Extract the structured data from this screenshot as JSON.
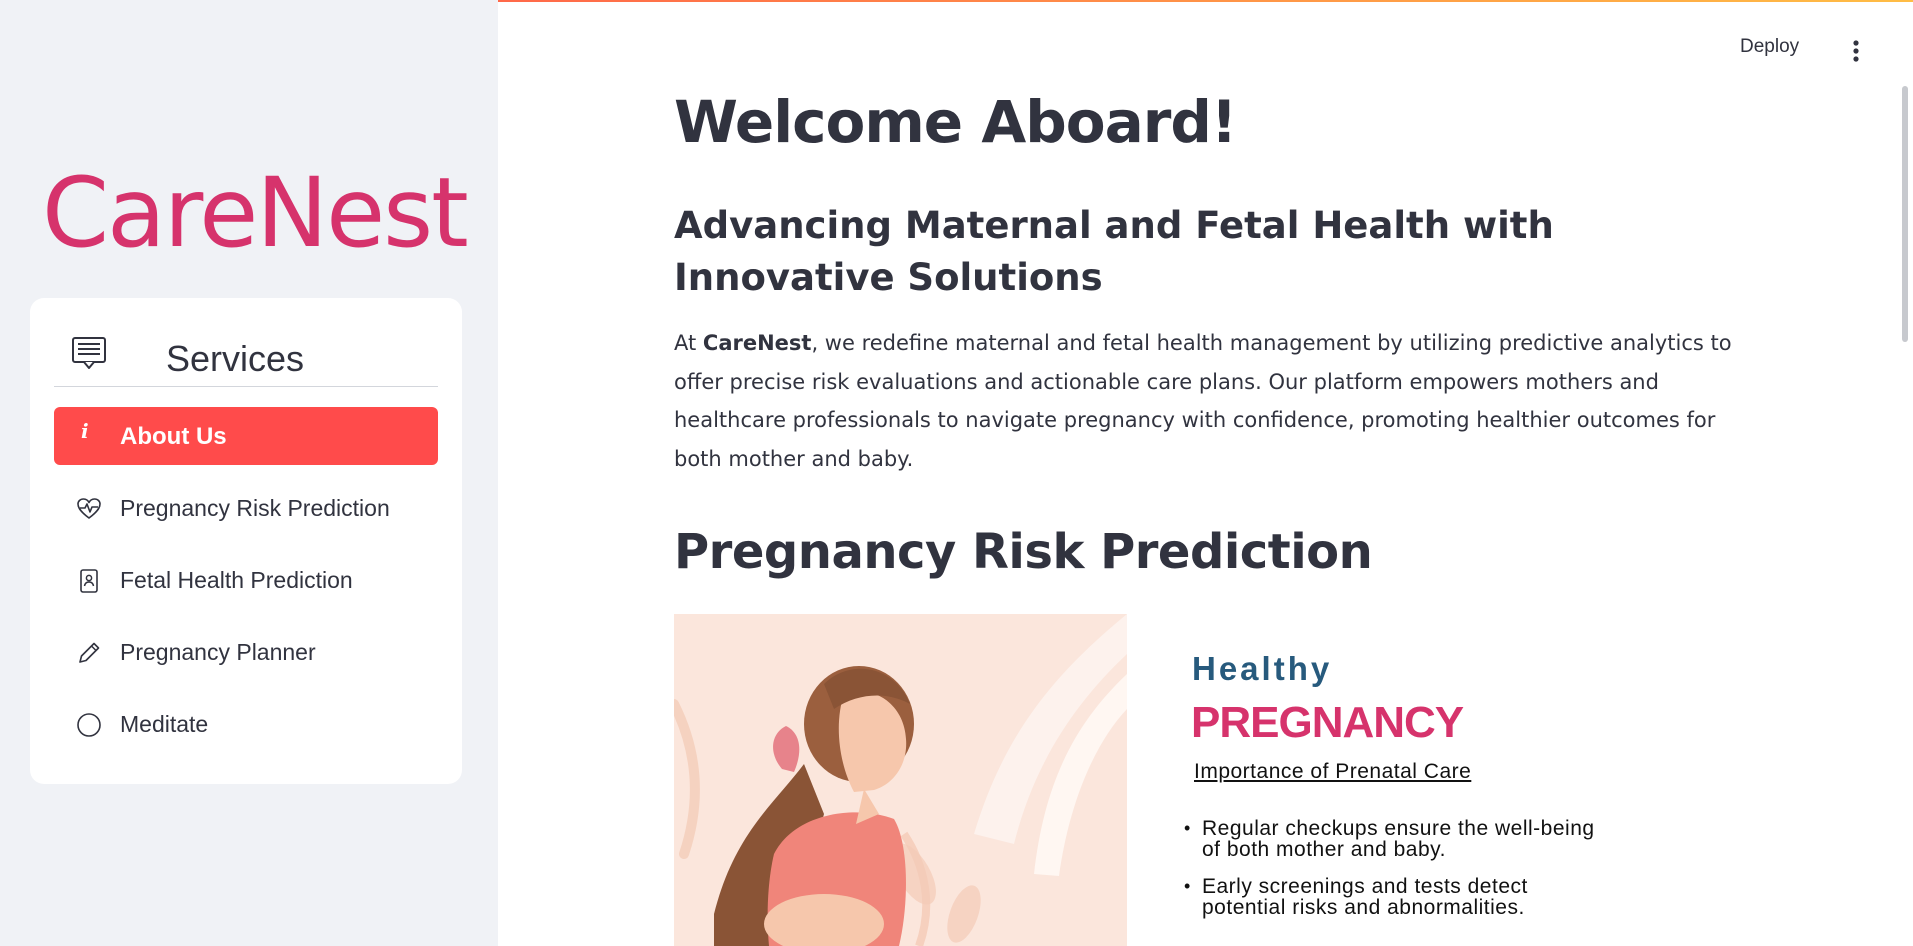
{
  "app": {
    "brand": "CareNest",
    "accent_color": "#ff4b4b",
    "brand_color": "#d6336c"
  },
  "header": {
    "deploy_label": "Deploy",
    "menu_icon": "kebab-menu-icon"
  },
  "sidebar": {
    "menu_title": "Services",
    "menu_icon": "message-square-icon",
    "items": [
      {
        "label": "About Us",
        "icon": "info-icon",
        "active": true
      },
      {
        "label": "Pregnancy Risk Prediction",
        "icon": "heart-pulse-icon",
        "active": false
      },
      {
        "label": "Fetal Health Prediction",
        "icon": "id-card-icon",
        "active": false
      },
      {
        "label": "Pregnancy Planner",
        "icon": "pencil-icon",
        "active": false
      },
      {
        "label": "Meditate",
        "icon": "circle-icon",
        "active": false
      }
    ]
  },
  "main": {
    "title": "Welcome Aboard!",
    "subtitle": "Advancing Maternal and Fetal Health with Innovative Solutions",
    "intro_prefix": "At ",
    "intro_brand": "CareNest",
    "intro_text": ", we redefine maternal and fetal health management by utilizing predictive analytics to offer precise risk evaluations and actionable care plans. Our platform empowers mothers and healthcare professionals to navigate pregnancy with confidence, promoting healthier outcomes for both mother and baby.",
    "section_title": "Pregnancy Risk Prediction",
    "promo": {
      "healthy": "Healthy",
      "pregnancy": "PREGNANCY",
      "subtitle": "Importance of Prenatal Care",
      "bullets": [
        "Regular checkups ensure the well-being of both mother and baby.",
        "Early screenings and tests detect potential risks and abnormalities."
      ]
    }
  }
}
